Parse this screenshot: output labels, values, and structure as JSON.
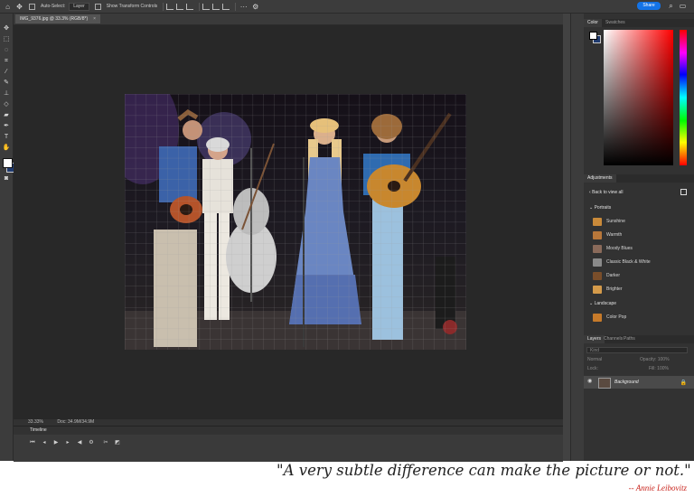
{
  "options_bar": {
    "auto_select_label": "Auto-Select:",
    "auto_select_value": "Layer",
    "show_transform_label": "Show Transform Controls",
    "share_label": "Share"
  },
  "tools": [
    "move-icon",
    "marquee-icon",
    "lasso-icon",
    "magic-wand-icon",
    "crop-icon",
    "frame-icon",
    "eyedropper-icon",
    "healing-icon",
    "brush-icon",
    "stamp-icon",
    "history-brush-icon",
    "eraser-icon",
    "gradient-icon",
    "blur-icon",
    "dodge-icon",
    "pen-icon",
    "type-icon",
    "path-select-icon",
    "rectangle-icon",
    "hand-icon",
    "zoom-icon",
    "more-icon"
  ],
  "document": {
    "tab_title": "IMG_9376.jpg @ 33.3% (RGB/8*)",
    "zoom_status": "33.33%",
    "doc_status": "Doc: 34.9M/34.9M"
  },
  "timeline": {
    "title": "Timeline"
  },
  "color_panel": {
    "tabs": [
      "Color",
      "Swatches"
    ],
    "foreground": "#ffffff",
    "background": "#1f3a6e"
  },
  "adjustments": {
    "title": "Adjustments",
    "back_label": "Back to view all",
    "sections": [
      {
        "name": "Portraits",
        "presets": [
          "Sunshine",
          "Warmth",
          "Moody Blues",
          "Classic Black & White",
          "Darker",
          "Brighter"
        ]
      },
      {
        "name": "Landscape",
        "presets": [
          "Color Pop"
        ]
      }
    ]
  },
  "layers_panel": {
    "tabs": [
      "Layers",
      "Channels",
      "Paths"
    ],
    "filter_placeholder": "Kind",
    "blend_mode": "Normal",
    "opacity": "Opacity: 100%",
    "lock_label": "Lock:",
    "fill": "Fill: 100%",
    "layers": [
      {
        "name": "Background"
      }
    ]
  },
  "caption": {
    "quote": "\"A very subtle difference can make the picture or not.\"",
    "author": "-- Annie Leibovitz"
  },
  "colors": {
    "accent": "#1473e6",
    "author_red": "#c9251e"
  }
}
